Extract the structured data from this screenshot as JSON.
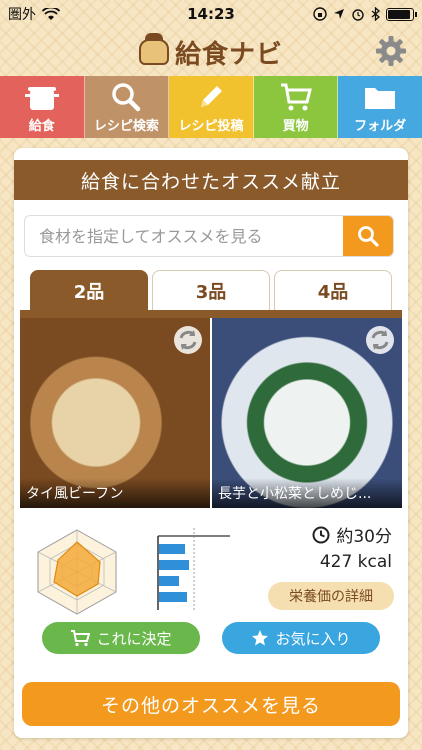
{
  "status": {
    "carrier": "圏外",
    "time": "14:23",
    "battery_level": 0.95
  },
  "header": {
    "title": "給食ナビ",
    "settings_icon": "gear-icon"
  },
  "nav": {
    "items": [
      {
        "label": "給食",
        "icon": "pot-icon",
        "color": "#e3625b"
      },
      {
        "label": "レシピ検索",
        "icon": "search-icon",
        "color": "#c09268"
      },
      {
        "label": "レシピ投稿",
        "icon": "pencil-icon",
        "color": "#f2c12e"
      },
      {
        "label": "買物",
        "icon": "cart-icon",
        "color": "#8cc63e"
      },
      {
        "label": "フォルダ",
        "icon": "folder-icon",
        "color": "#46a8e0"
      }
    ]
  },
  "recommend": {
    "title": "給食に合わせたオススメ献立",
    "search_placeholder": "食材を指定してオススメを見る",
    "tabs": [
      "2品",
      "3品",
      "4品"
    ],
    "active_tab": 0,
    "dishes": [
      {
        "name": "タイ風ビーフン"
      },
      {
        "name": "長芋と小松菜としめじ..."
      }
    ],
    "time": "約30分",
    "kcal": "427 kcal",
    "detail_label": "栄養価の詳細",
    "decide_label": "これに決定",
    "favorite_label": "お気に入り",
    "more_label": "その他のオススメを見る"
  },
  "colors": {
    "brown": "#8a5a2b",
    "orange": "#f39a1e",
    "green": "#6ab84c",
    "blue": "#3aa6e0"
  }
}
